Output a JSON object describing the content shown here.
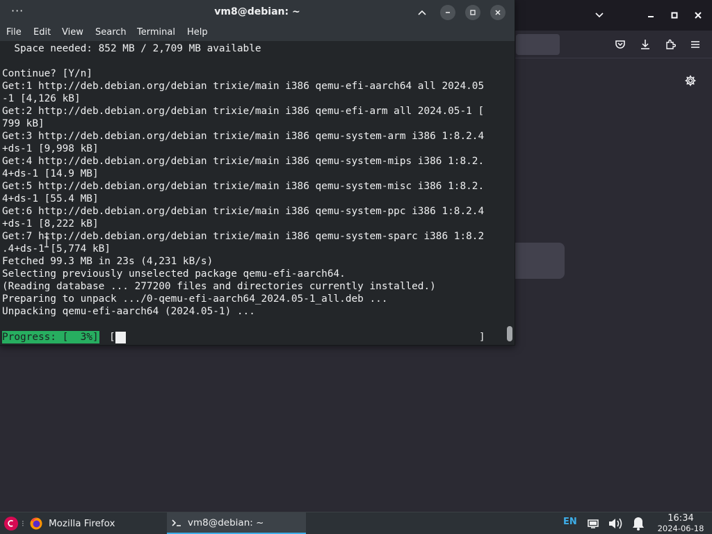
{
  "firefox": {
    "window_controls": [
      "chevron-down-icon",
      "minimize-icon",
      "maximize-icon",
      "close-icon"
    ],
    "toolbar_icons": [
      "pocket-icon",
      "download-icon",
      "extensions-icon",
      "menu-icon"
    ],
    "settings_icon": "gear-icon"
  },
  "terminal": {
    "title": "vm8@debian: ~",
    "menu": [
      "File",
      "Edit",
      "View",
      "Search",
      "Terminal",
      "Help"
    ],
    "lines": [
      "  Space needed: 852 MB / 2,709 MB available",
      "",
      "Continue? [Y/n]",
      "Get:1 http://deb.debian.org/debian trixie/main i386 qemu-efi-aarch64 all 2024.05",
      "-1 [4,126 kB]",
      "Get:2 http://deb.debian.org/debian trixie/main i386 qemu-efi-arm all 2024.05-1 [",
      "799 kB]",
      "Get:3 http://deb.debian.org/debian trixie/main i386 qemu-system-arm i386 1:8.2.4",
      "+ds-1 [9,998 kB]",
      "Get:4 http://deb.debian.org/debian trixie/main i386 qemu-system-mips i386 1:8.2.",
      "4+ds-1 [14.9 MB]",
      "Get:5 http://deb.debian.org/debian trixie/main i386 qemu-system-misc i386 1:8.2.",
      "4+ds-1 [55.4 MB]",
      "Get:6 http://deb.debian.org/debian trixie/main i386 qemu-system-ppc i386 1:8.2.4",
      "+ds-1 [8,222 kB]",
      "Get:7 http://deb.debian.org/debian trixie/main i386 qemu-system-sparc i386 1:8.2",
      ".4+ds-1 [5,774 kB]",
      "Fetched 99.3 MB in 23s (4,231 kB/s)",
      "Selecting previously unselected package qemu-efi-aarch64.",
      "(Reading database ... 277200 files and directories currently installed.)",
      "Preparing to unpack .../0-qemu-efi-aarch64_2024.05-1_all.deb ...",
      "Unpacking qemu-efi-aarch64 (2024.05-1) ..."
    ],
    "progress": {
      "label": "Progress: [  3%]",
      "bar_open": "[",
      "bar_close": "]",
      "percent": 3
    }
  },
  "taskbar": {
    "tasks": [
      {
        "label": "Mozilla Firefox",
        "icon": "firefox-icon",
        "active": false
      },
      {
        "label": "vm8@debian: ~",
        "icon": "terminal-icon",
        "active": true
      }
    ],
    "language": "EN",
    "clock_time": "16:34",
    "clock_date": "2024-06-18",
    "tray_icons": [
      "screen-icon",
      "volume-icon",
      "notification-bell-icon"
    ]
  },
  "colors": {
    "accent": "#3daee9",
    "progress_green": "#27ae60",
    "terminal_bg": "#232629",
    "debian_red": "#d70a53"
  }
}
